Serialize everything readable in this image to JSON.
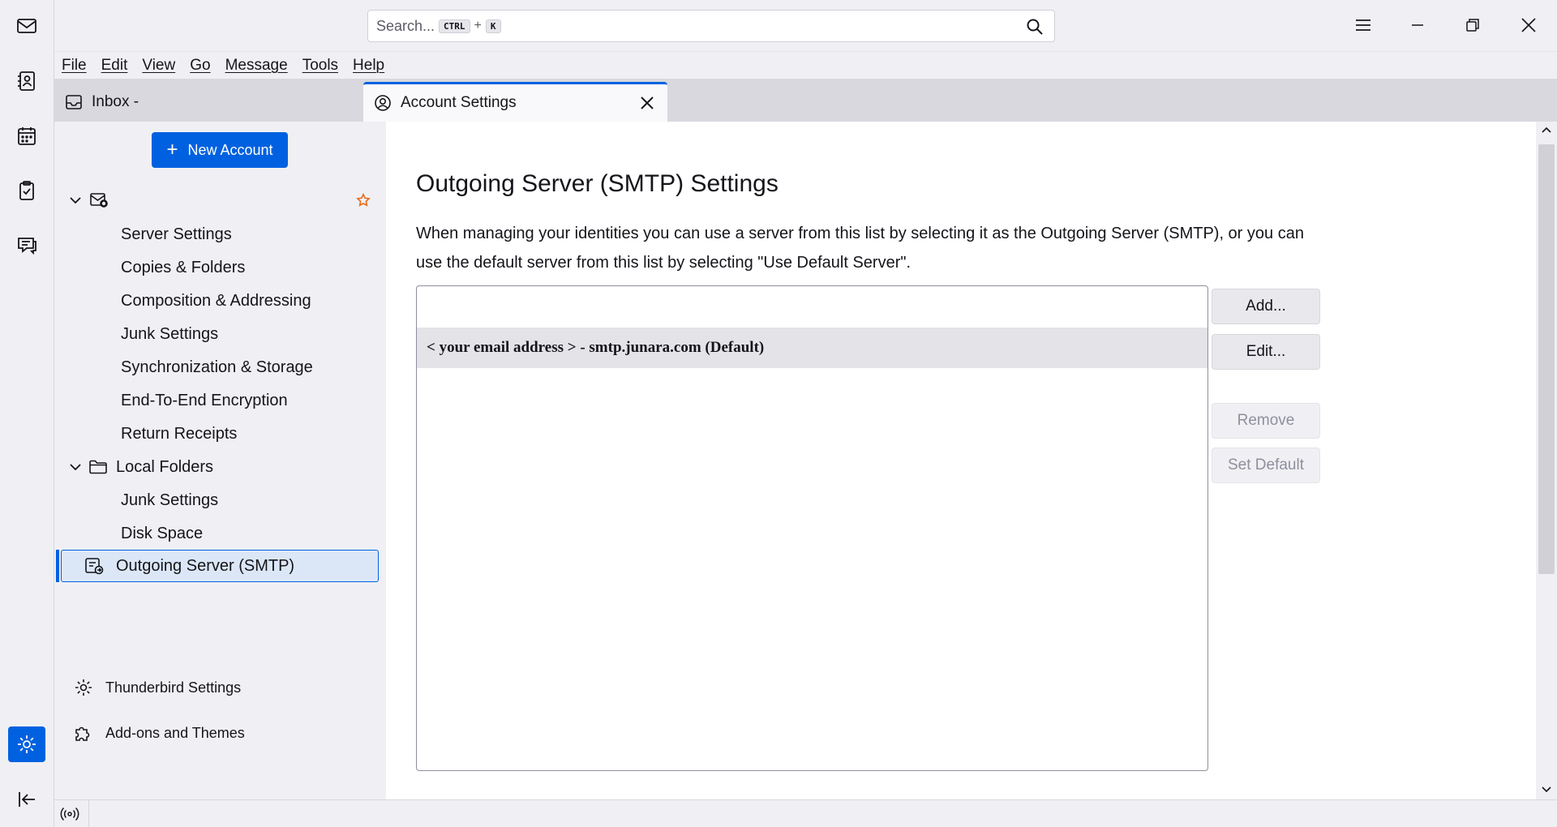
{
  "search": {
    "placeholder": "Search...",
    "shortcut_mod": "CTRL",
    "shortcut_plus": "+",
    "shortcut_key": "K"
  },
  "menu": [
    "File",
    "Edit",
    "View",
    "Go",
    "Message",
    "Tools",
    "Help"
  ],
  "tabs": {
    "inbox": "Inbox -",
    "account_settings": "Account Settings"
  },
  "sidebar": {
    "new_account_plus": "+",
    "new_account": "New Account",
    "account_items": [
      "Server Settings",
      "Copies & Folders",
      "Composition & Addressing",
      "Junk Settings",
      "Synchronization & Storage",
      "End-To-End Encryption",
      "Return Receipts"
    ],
    "local_folders": "Local Folders",
    "local_items": [
      "Junk Settings",
      "Disk Space"
    ],
    "outgoing": "Outgoing Server (SMTP)",
    "thunderbird_settings": "Thunderbird Settings",
    "addons": "Add-ons and Themes"
  },
  "main": {
    "title": "Outgoing Server (SMTP) Settings",
    "description": "When managing your identities you can use a server from this list by selecting it as the Outgoing Server (SMTP), or you can use the default server from this list by selecting \"Use Default Server\".",
    "servers": [
      "< your email address > - smtp.junara.com (Default)"
    ],
    "buttons": {
      "add": "Add...",
      "edit": "Edit...",
      "remove": "Remove",
      "set_default": "Set Default"
    }
  },
  "colors": {
    "accent": "#0061e0",
    "star": "#e66a17"
  }
}
